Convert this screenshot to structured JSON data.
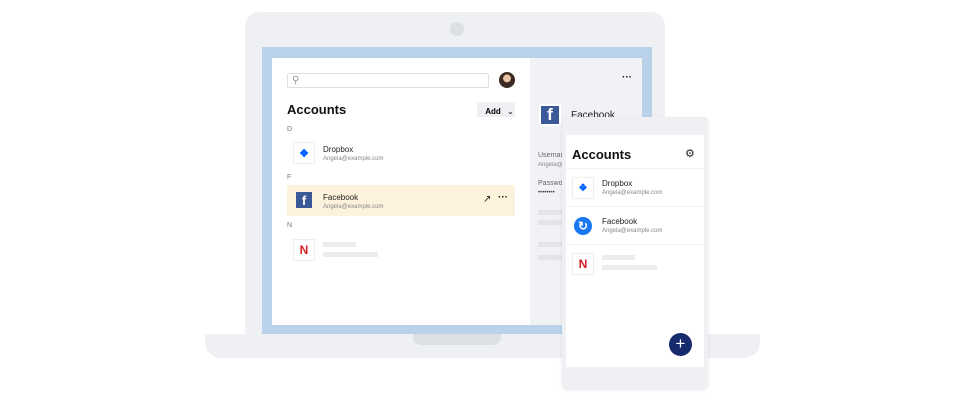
{
  "desktop": {
    "search": {
      "placeholder": ""
    },
    "title": "Accounts",
    "add_label": "Add",
    "sections": [
      {
        "letter": "D",
        "items": [
          {
            "name": "Dropbox",
            "email": "Angela@example.com"
          }
        ]
      },
      {
        "letter": "F",
        "items": [
          {
            "name": "Facebook",
            "email": "Angela@example.com"
          }
        ]
      },
      {
        "letter": "N",
        "items": [
          {
            "name": "",
            "email": ""
          }
        ]
      }
    ],
    "detail": {
      "title": "Facebook",
      "username_label": "Username",
      "username_value": "Angela@example.com",
      "password_label": "Password",
      "password_value": "••••••••"
    }
  },
  "mobile": {
    "title": "Accounts",
    "items": [
      {
        "name": "Dropbox",
        "email": "Angela@example.com"
      },
      {
        "name": "Facebook",
        "email": "Angela@example.com"
      },
      {
        "name": "",
        "email": ""
      }
    ],
    "fab": "+"
  },
  "colors": {
    "accent": "#172a6e",
    "highlight": "#fdf3dc",
    "screen": "#b9d2ea"
  }
}
